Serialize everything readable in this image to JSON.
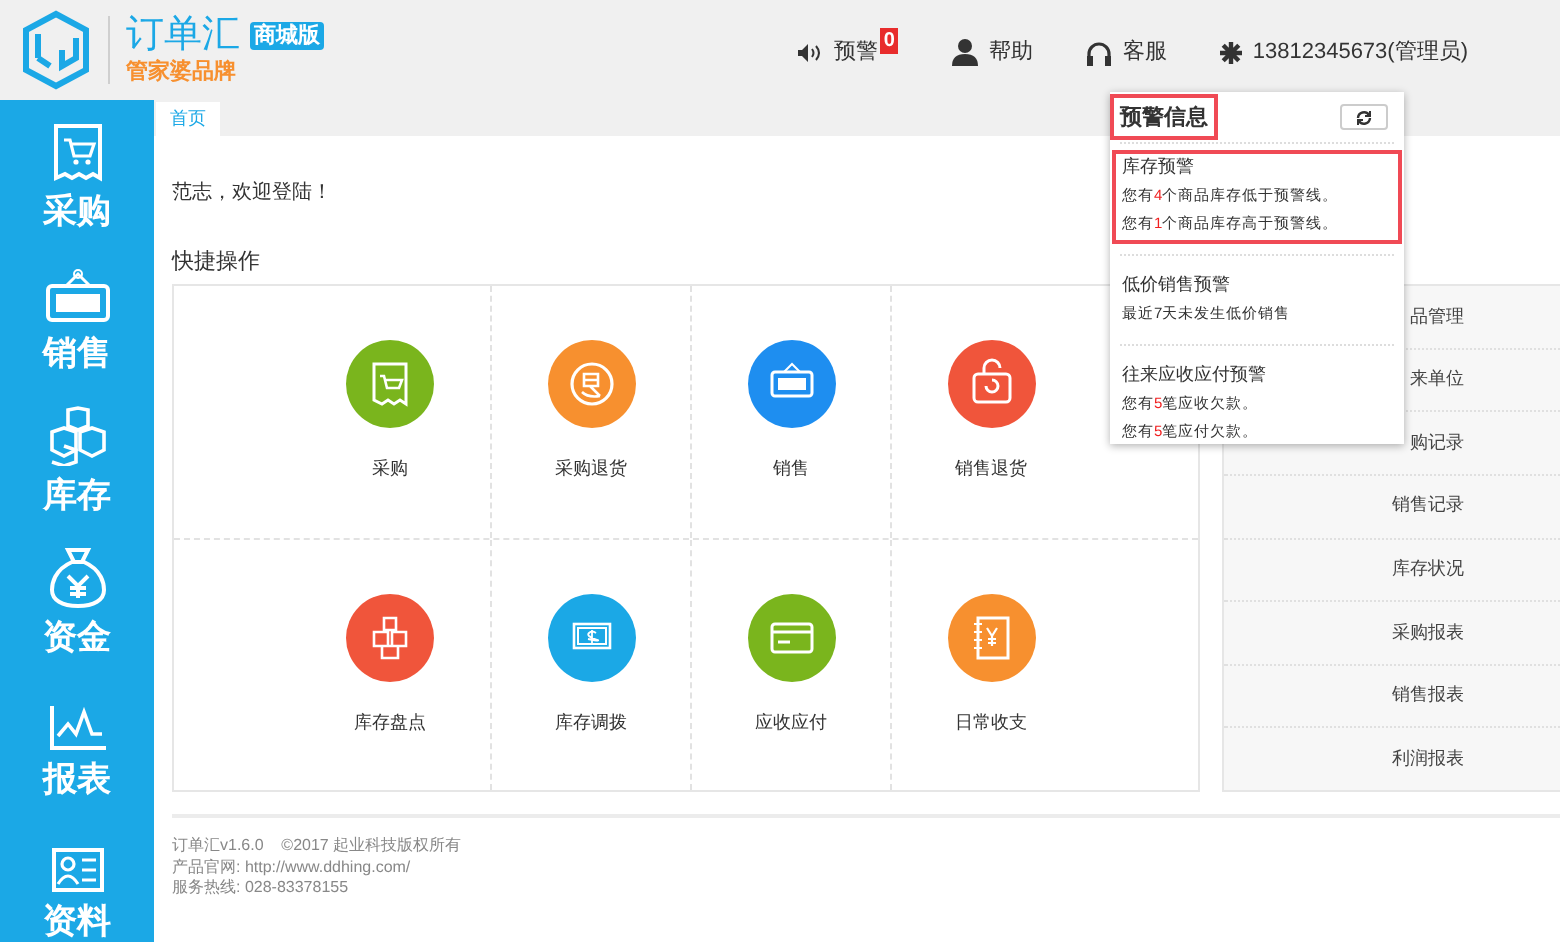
{
  "header": {
    "brand": "订单汇",
    "edition": "商城版",
    "subtitle": "管家婆品牌",
    "links": [
      {
        "label": "预警",
        "badge": "0"
      },
      {
        "label": "帮助"
      },
      {
        "label": "客服"
      },
      {
        "label": "13812345673(管理员)"
      }
    ]
  },
  "sidebar": {
    "items": [
      {
        "label": "采购"
      },
      {
        "label": "销售"
      },
      {
        "label": "库存"
      },
      {
        "label": "资金"
      },
      {
        "label": "报表"
      },
      {
        "label": "资料"
      }
    ]
  },
  "tabs": [
    {
      "label": "首页",
      "selected": true
    }
  ],
  "welcome": "范志，欢迎登陆！",
  "quick_actions": {
    "title": "快捷操作",
    "items": [
      {
        "label": "采购",
        "color": "#7ab51d"
      },
      {
        "label": "采购退货",
        "color": "#f7902f"
      },
      {
        "label": "销售",
        "color": "#1e8ef0"
      },
      {
        "label": "销售退货",
        "color": "#f0553b"
      },
      {
        "label": "库存盘点",
        "color": "#f0553b"
      },
      {
        "label": "库存调拨",
        "color": "#1ba8e6"
      },
      {
        "label": "应收应付",
        "color": "#7ab51d"
      },
      {
        "label": "日常收支",
        "color": "#f7902f"
      }
    ]
  },
  "shortcuts": [
    "品管理",
    "来单位",
    "购记录",
    "销售记录",
    "库存状况",
    "采购报表",
    "销售报表",
    "利润报表"
  ],
  "alert_popup": {
    "title": "预警信息",
    "title_highlighted": true,
    "sections": [
      {
        "title": "库存预警",
        "highlighted": true,
        "lines": [
          {
            "prefix": "您有",
            "count": "4",
            "suffix": "个商品库存低于预警线。"
          },
          {
            "prefix": "您有",
            "count": "1",
            "suffix": "个商品库存高于预警线。"
          }
        ]
      },
      {
        "title": "低价销售预警",
        "highlighted": false,
        "lines": [
          {
            "prefix": "最近7天未发生低价销售"
          }
        ]
      },
      {
        "title": "往来应收应付预警",
        "highlighted": false,
        "lines": [
          {
            "prefix": "您有",
            "count": "5",
            "suffix": "笔应收欠款。"
          },
          {
            "prefix": "您有",
            "count": "5",
            "suffix": "笔应付欠款。"
          }
        ]
      }
    ]
  },
  "footer": [
    "订单汇v1.6.0    ©2017 起业科技版权所有",
    "产品官网: http://www.ddhing.com/",
    "服务热线: 028-83378155"
  ]
}
